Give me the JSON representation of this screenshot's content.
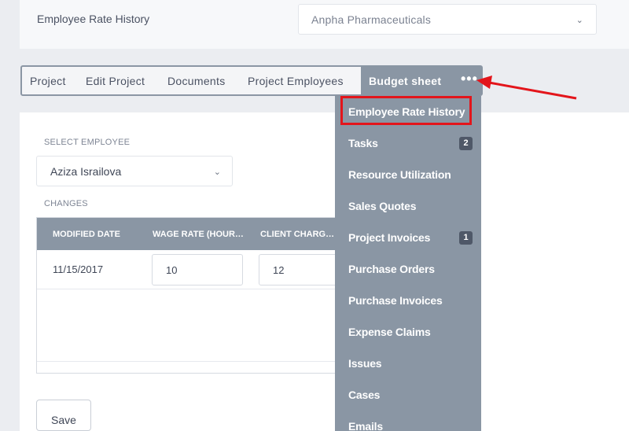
{
  "header": {
    "title": "Employee Rate History",
    "company": "Anpha Pharmaceuticals"
  },
  "tabs": {
    "items": [
      "Project",
      "Edit Project",
      "Documents",
      "Project Employees"
    ],
    "active": "Budget sheet",
    "more": "•••"
  },
  "form": {
    "select_employee_label": "SELECT EMPLOYEE",
    "employee": "Aziza Israilova",
    "changes_label": "CHANGES"
  },
  "table": {
    "columns": [
      "MODIFIED DATE",
      "WAGE RATE (HOURLY)",
      "CLIENT CHARGE RATE"
    ],
    "rows": [
      {
        "modified_date": "11/15/2017",
        "wage_rate": "10",
        "client_charge": "12"
      }
    ]
  },
  "save_label": "Save",
  "menu": {
    "items": [
      {
        "label": "Employee Rate History"
      },
      {
        "label": "Tasks",
        "badge": "2"
      },
      {
        "label": "Resource Utilization"
      },
      {
        "label": "Sales Quotes"
      },
      {
        "label": "Project Invoices",
        "badge": "1"
      },
      {
        "label": "Purchase Orders"
      },
      {
        "label": "Purchase Invoices"
      },
      {
        "label": "Expense Claims"
      },
      {
        "label": "Issues"
      },
      {
        "label": "Cases"
      },
      {
        "label": "Emails"
      }
    ]
  },
  "colors": {
    "accent": "#8a96a4",
    "highlight": "#e3151b"
  }
}
